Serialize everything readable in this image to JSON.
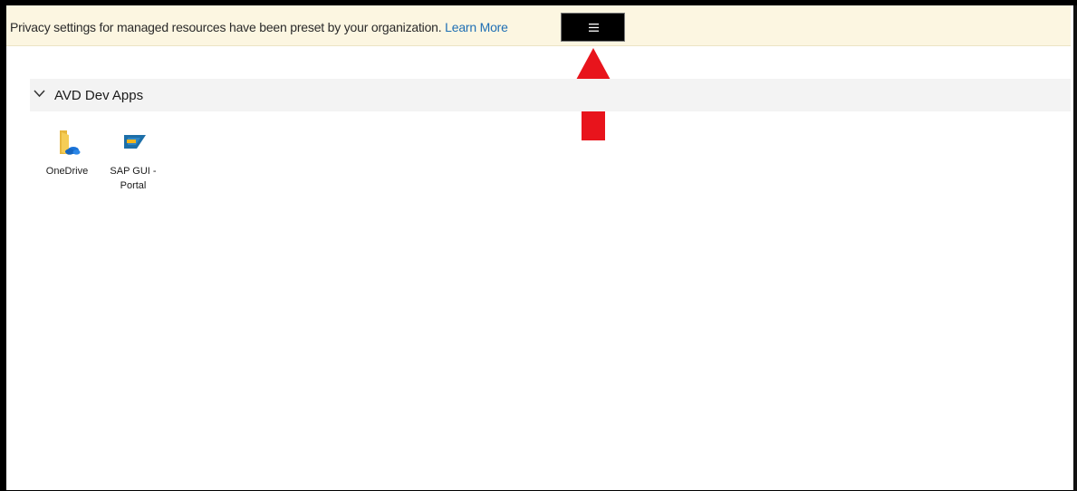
{
  "info_bar": {
    "message": "Privacy settings for managed resources have been preset by your organization.",
    "link_text": "Learn More"
  },
  "toolbar": {
    "menu_icon": "hamburger-menu-icon"
  },
  "annotation": {
    "arrow_icon": "red-arrow-up-icon",
    "arrow_color": "#e8141c"
  },
  "group": {
    "title": "AVD Dev Apps",
    "chevron_icon": "chevron-down-icon",
    "apps": [
      {
        "label_line1": "OneDrive",
        "label_line2": "",
        "icon": "onedrive-icon"
      },
      {
        "label_line1": "SAP GUI -",
        "label_line2": "Portal",
        "icon": "sap-gui-icon"
      }
    ]
  },
  "colors": {
    "info_bar_bg": "#fcf6e1",
    "link": "#1f6fb4",
    "group_header_bg": "#f3f3f3"
  }
}
